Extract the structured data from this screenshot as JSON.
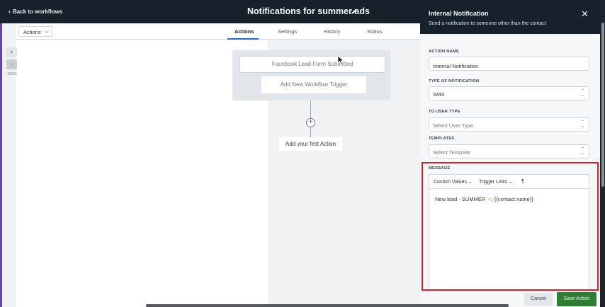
{
  "topbar": {
    "back_label": "Back to workflows",
    "workflow_title": "Notifications for summer ads",
    "icons": {
      "back": "chevron-left-icon",
      "edit": "pencil-icon"
    }
  },
  "canvas": {
    "actions_dropdown": "Actions",
    "tabs": [
      {
        "label": "Actions",
        "active": true
      },
      {
        "label": "Settings",
        "active": false
      },
      {
        "label": "History",
        "active": false
      },
      {
        "label": "Status",
        "active": false
      }
    ],
    "zoom": {
      "plus": "+",
      "minus": "−",
      "level": "100%"
    },
    "trigger_card": "Facebook Lead Form Submitted",
    "add_trigger": "Add New Workflow Trigger",
    "add_action_icon": "+",
    "first_action": "Add your first Action"
  },
  "panel": {
    "title": "Internal Notification",
    "subtitle": "Send a notification to someone other than the contact",
    "close": "✕",
    "action_name": {
      "label": "ACTION NAME",
      "value": "Internal Notification"
    },
    "type_of_notification": {
      "label": "TYPE OF NOTIFICATION",
      "value": "SMS"
    },
    "to_user_type": {
      "label": "TO USER TYPE",
      "placeholder": "Select User Type"
    },
    "templates": {
      "label": "TEMPLATES",
      "placeholder": "Select Template"
    },
    "message": {
      "label": "MESSAGE",
      "toolbar": {
        "custom_values": "Custom Values",
        "trigger_links": "Trigger Links",
        "paragraph": "¶"
      },
      "text_prefix": "New lead - SUMMER ",
      "emoji": "☀",
      "text_suffix": ": {{contact.name}}"
    },
    "buttons": {
      "cancel": "Cancel",
      "save": "Save Action"
    }
  },
  "colors": {
    "header_bg": "#17212c",
    "save_green": "#2e7d32",
    "highlight_red": "#e01b24",
    "tab_active_underline": "#2b6cdb"
  }
}
